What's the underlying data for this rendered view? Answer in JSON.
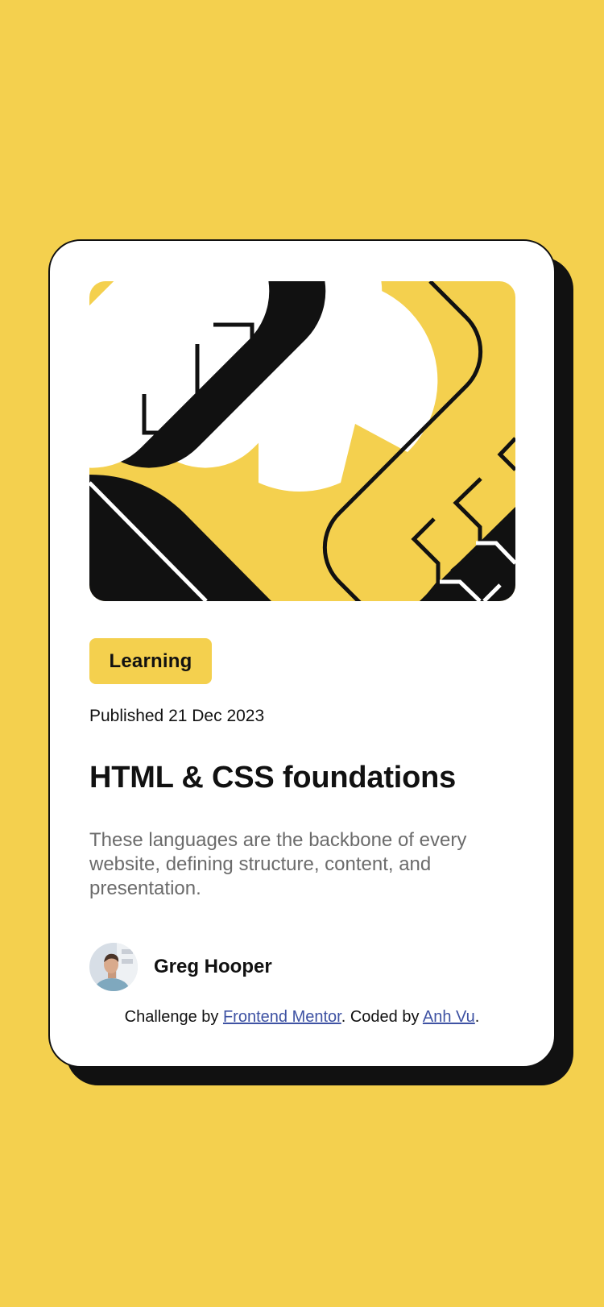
{
  "colors": {
    "page_background": "#F4D04E",
    "card_background": "#FFFFFF",
    "ink": "#111111",
    "muted_text": "#6B6B6B",
    "link": "#3E52A3"
  },
  "card": {
    "hero_image": "abstract-geometric-illustration",
    "tag": "Learning",
    "published": "Published 21 Dec 2023",
    "title": "HTML & CSS foundations",
    "description": "These languages are the backbone of every website, defining structure, content, and presentation.",
    "author": {
      "name": "Greg Hooper",
      "avatar": "author-avatar-photo"
    }
  },
  "attribution": {
    "prefix": "Challenge by ",
    "link1": "Frontend Mentor",
    "middle": ". Coded by ",
    "link2": "Anh Vu",
    "suffix": "."
  }
}
